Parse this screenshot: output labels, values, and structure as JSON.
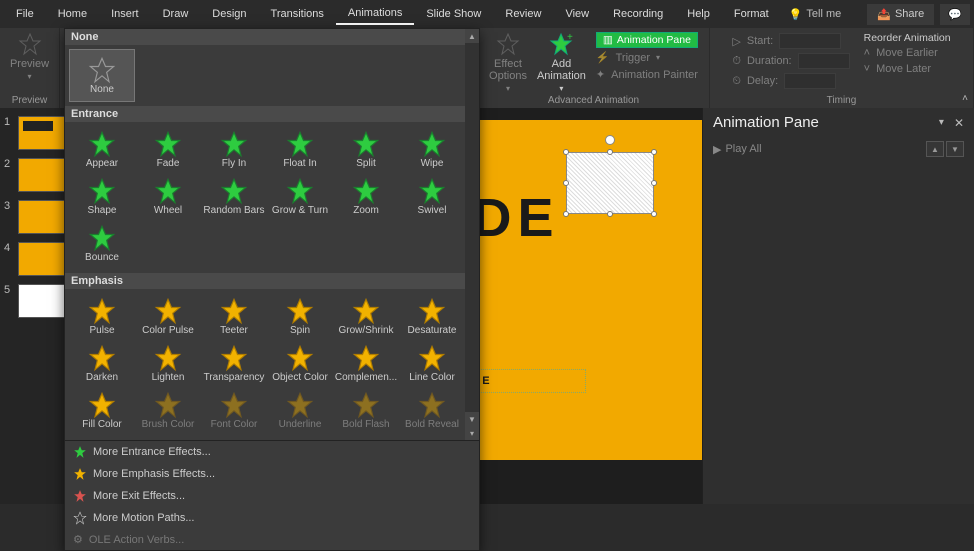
{
  "menubar": {
    "tabs": [
      "File",
      "Home",
      "Insert",
      "Draw",
      "Design",
      "Transitions",
      "Animations",
      "Slide Show",
      "Review",
      "View",
      "Recording",
      "Help",
      "Format"
    ],
    "active_index": 6,
    "tell_me": "Tell me",
    "share": "Share"
  },
  "ribbon": {
    "preview_group": {
      "button": "Preview",
      "label": "Preview"
    },
    "advanced_group": {
      "effect_options": "Effect\nOptions",
      "add_animation": "Add\nAnimation",
      "animation_pane": "Animation Pane",
      "trigger": "Trigger",
      "animation_painter": "Animation Painter",
      "label": "Advanced Animation"
    },
    "timing_group": {
      "start": "Start:",
      "duration": "Duration:",
      "delay": "Delay:",
      "reorder": "Reorder Animation",
      "move_earlier": "Move Earlier",
      "move_later": "Move Later",
      "label": "Timing"
    }
  },
  "gallery": {
    "none_header": "None",
    "none_item": "None",
    "entrance_header": "Entrance",
    "entrance_items": [
      "Appear",
      "Fade",
      "Fly In",
      "Float In",
      "Split",
      "Wipe",
      "Shape",
      "Wheel",
      "Random Bars",
      "Grow & Turn",
      "Zoom",
      "Swivel",
      "Bounce"
    ],
    "emphasis_header": "Emphasis",
    "emphasis_items": [
      "Pulse",
      "Color Pulse",
      "Teeter",
      "Spin",
      "Grow/Shrink",
      "Desaturate",
      "Darken",
      "Lighten",
      "Transparency",
      "Object Color",
      "Complemen...",
      "Line Color",
      "Fill Color",
      "Brush Color",
      "Font Color",
      "Underline",
      "Bold Flash",
      "Bold Reveal"
    ],
    "emphasis_disabled": [
      "Brush Color",
      "Font Color",
      "Underline",
      "Bold Flash",
      "Bold Reveal"
    ],
    "footer": {
      "more_entrance": "More Entrance Effects...",
      "more_emphasis": "More Emphasis Effects...",
      "more_exit": "More Exit Effects...",
      "more_motion": "More Motion Paths...",
      "ole_verbs": "OLE Action Verbs..."
    }
  },
  "thumbnails": [
    1,
    2,
    3,
    4,
    5
  ],
  "slide": {
    "big_text": "DE",
    "subtitle": "TITLE"
  },
  "anim_pane": {
    "title": "Animation Pane",
    "play_all": "Play All"
  },
  "colors": {
    "entrance_star": "#2ecc40",
    "emphasis_star": "#f2b200",
    "exit_star": "#d9534f"
  }
}
